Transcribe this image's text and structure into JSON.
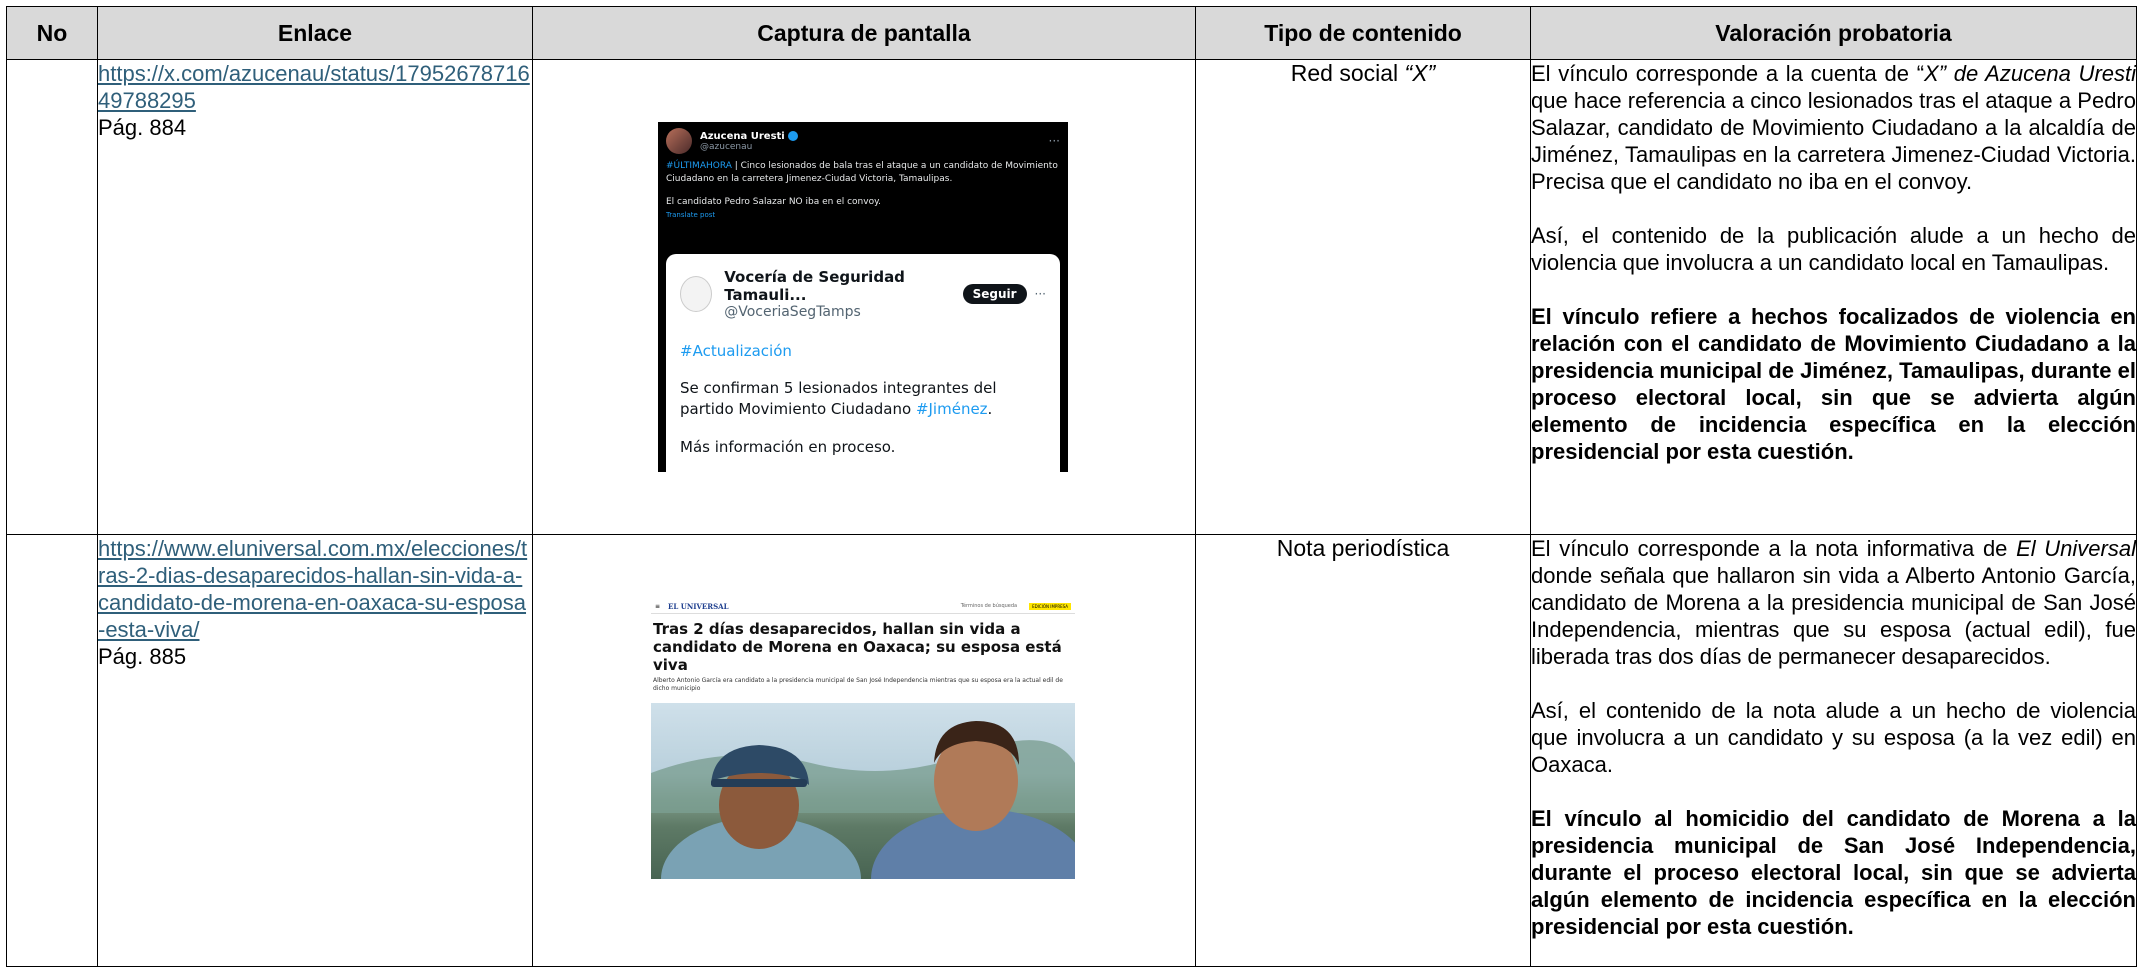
{
  "table": {
    "headers": [
      "No",
      "Enlace",
      "Captura de pantalla",
      "Tipo de contenido",
      "Valoración probatoria"
    ],
    "rows": [
      {
        "no": "",
        "link_url": "https://x.com/azucenau/status/1795267871649788295",
        "page": "Pág. 884",
        "type_text": "Red social ",
        "type_em": "“X”",
        "val_p1_a": "El vínculo corresponde a la cuenta de “",
        "val_p1_em": "X” de Azucena Uresti",
        "val_p1_b": " que hace referencia a cinco lesionados tras el ataque a Pedro Salazar, candidato de Movimiento Ciudadano a la alcaldía de Jiménez, Tamaulipas en la carretera Jimenez-Ciudad Victoria. Precisa que el candidato no iba en el convoy.",
        "val_p2": "Así, el contenido de la publicación alude a un hecho de violencia que involucra a un candidato local en Tamaulipas.",
        "val_p3": "El vínculo refiere a hechos focalizados de violencia en relación con el candidato de Movimiento Ciudadano a la presidencia municipal de Jiménez, Tamaulipas, durante el proceso electoral local, sin que se advierta algún elemento de incidencia específica en la elección presidencial por esta cuestión.",
        "screenshot": {
          "author": "Azucena Uresti",
          "handle": "@azucenau",
          "more": "···",
          "hashtag": "#ÚLTIMAHORA",
          "text1": " | Cinco lesionados de bala tras el ataque a un candidato de Movimiento Ciudadano en la carretera Jimenez-Ciudad Victoria, Tamaulipas.",
          "text2": "El candidato Pedro Salazar NO iba en el convoy.",
          "translate": "Translate post",
          "card_name": "Vocería de Seguridad Tamauli...",
          "card_handle": "@VoceriaSegTamps",
          "follow": "Seguir",
          "card_hashtag": "#Actualización",
          "card_body": "Se confirman 5 lesionados integrantes del partido Movimiento Ciudadano ",
          "card_body_tag": "#Jiménez",
          "card_body_end": ".",
          "card_more": "Más información en proceso."
        }
      },
      {
        "no": "",
        "link_url": "https://www.eluniversal.com.mx/elecciones/tras-2-dias-desaparecidos-hallan-sin-vida-a-candidato-de-morena-en-oaxaca-su-esposa-esta-viva/",
        "page": "Pág. 885",
        "type_text": "Nota periodística",
        "val_p1_a": "El vínculo corresponde a la nota informativa de ",
        "val_p1_em": "El Universal",
        "val_p1_b": " donde señala que hallaron sin vida a Alberto Antonio García, candidato de Morena a la presidencia municipal de San José Independencia, mientras que su esposa (actual edil), fue liberada tras dos días de permanecer desaparecidos.",
        "val_p2": "Así, el contenido de la nota alude a un hecho de violencia que involucra a un candidato y su esposa (a la vez edil) en Oaxaca.",
        "val_p3": "El vínculo al homicidio del candidato de Morena a la presidencia municipal de San José Independencia, durante el proceso electoral local, sin que se advierta algún elemento de incidencia específica en la elección presidencial por esta cuestión.",
        "screenshot": {
          "menu": "≡",
          "logo": "EL UNIVERSAL",
          "search": "Términos de búsqueda",
          "badge": "EDICIÓN IMPRESA",
          "title": "Tras 2 días desaparecidos, hallan sin vida a candidato de Morena en Oaxaca; su esposa está viva",
          "subtitle": "Alberto Antonio García era candidato a la presidencia municipal de San José Independencia mientras que su esposa era la actual edil de dicho municipio"
        }
      }
    ]
  },
  "colors": {
    "header_bg": "#d9d9d9",
    "link": "#2f5f7a",
    "border": "#000000"
  }
}
